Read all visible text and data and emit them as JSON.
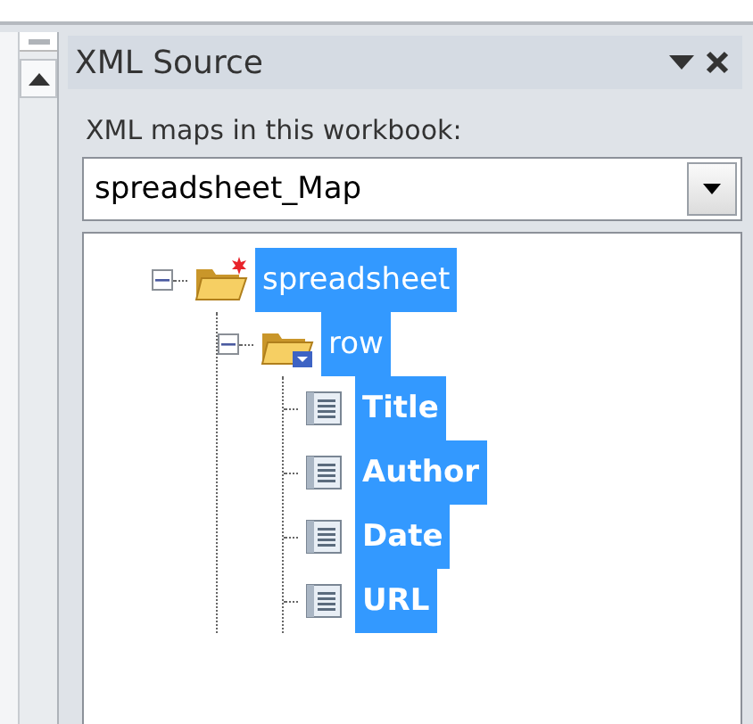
{
  "panel": {
    "title": "XML Source",
    "maps_label": "XML maps in this workbook:",
    "map_select": {
      "value": "spreadsheet_Map"
    }
  },
  "tree": [
    {
      "label": "spreadsheet",
      "kind": "root",
      "selected": true,
      "expanded": true,
      "children": [
        {
          "label": "row",
          "kind": "repeating",
          "selected": true,
          "expanded": true,
          "children": [
            {
              "label": "Title",
              "kind": "field",
              "selected": true
            },
            {
              "label": "Author",
              "kind": "field",
              "selected": true
            },
            {
              "label": "Date",
              "kind": "field",
              "selected": true
            },
            {
              "label": "URL",
              "kind": "field",
              "selected": true
            }
          ]
        }
      ]
    }
  ]
}
